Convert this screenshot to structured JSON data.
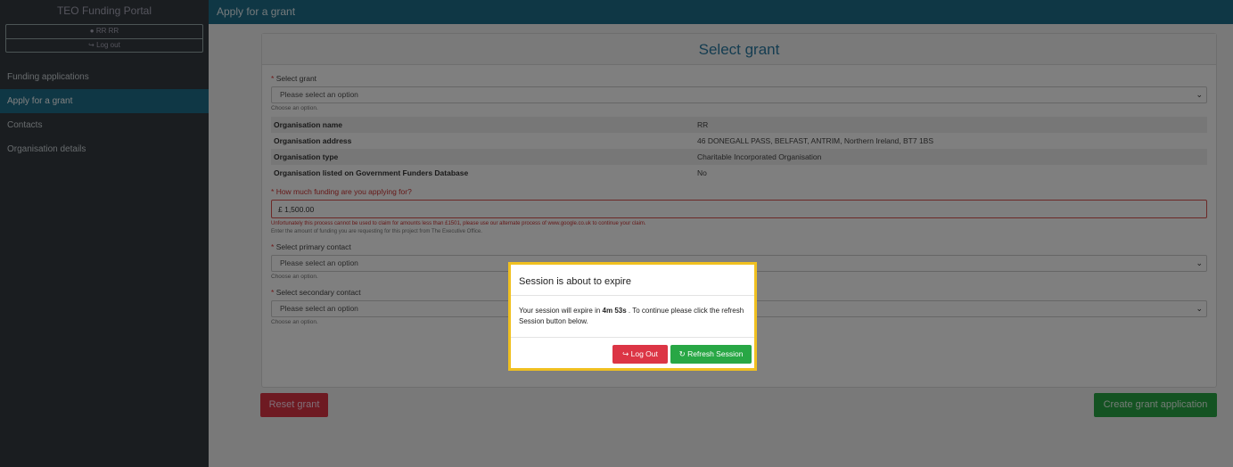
{
  "sidebar": {
    "app_title": "TEO Funding Portal",
    "user_name": "RR RR",
    "logout_label": "Log out",
    "items": [
      {
        "label": "Funding applications"
      },
      {
        "label": "Apply for a grant"
      },
      {
        "label": "Contacts"
      },
      {
        "label": "Organisation details"
      }
    ],
    "active_item": "Apply for a grant"
  },
  "header": {
    "title": "Apply for a grant"
  },
  "form": {
    "title": "Select grant",
    "select_grant": {
      "label": "Select grant",
      "value": "Please select an option",
      "hint": "Choose an option."
    },
    "organisation": [
      {
        "key": "Organisation name",
        "value": "RR"
      },
      {
        "key": "Organisation address",
        "value": "46 DONEGALL PASS, BELFAST, ANTRIM, Northern Ireland, BT7 1BS"
      },
      {
        "key": "Organisation type",
        "value": "Charitable Incorporated Organisation"
      },
      {
        "key": "Organisation listed on Government Funders Database",
        "value": "No"
      }
    ],
    "funding": {
      "label": "How much funding are you applying for?",
      "value": "£ 1,500.00",
      "error": "Unfortunately this process cannot be used to claim for amounts less than £1501, please use our alternate process of www.google.co.uk to continue your claim.",
      "hint": "Enter the amount of funding you are requesting for this project from The Executive Office."
    },
    "primary_contact": {
      "label": "Select primary contact",
      "value": "Please select an option",
      "hint": "Choose an option."
    },
    "secondary_contact": {
      "label": "Select secondary contact",
      "value": "Please select an option",
      "hint": "Choose an option."
    },
    "reset_label": "Reset grant",
    "create_label": "Create grant application"
  },
  "modal": {
    "title": "Session is about to expire",
    "body_prefix": "Your session will expire in",
    "countdown": "4m 53s",
    "body_suffix": ". To continue please click the refresh Session button below.",
    "logout_label": "Log Out",
    "refresh_label": "Refresh Session"
  },
  "colors": {
    "sidebar_bg": "#343a40",
    "accent": "#1f6f8b",
    "danger": "#dc3545",
    "success": "#28a745",
    "modal_border": "#f0c020"
  },
  "icons": {
    "user": "user-circle-icon",
    "logout": "sign-out-icon",
    "refresh": "refresh-icon",
    "chevron": "chevron-down-icon"
  }
}
